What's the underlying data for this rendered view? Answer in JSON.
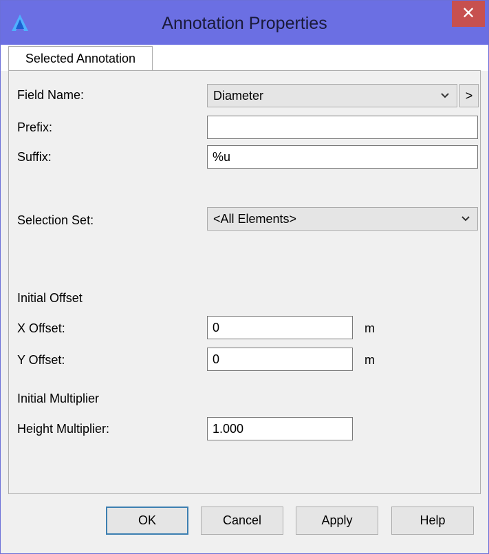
{
  "window": {
    "title": "Annotation Properties",
    "close_glyph": "✕",
    "app_icon": "app-logo-icon",
    "titlebar_color": "#6b6fe3",
    "close_color": "#c7504f"
  },
  "tabs": [
    {
      "label": "Selected Annotation",
      "active": true
    }
  ],
  "form": {
    "field_name": {
      "label": "Field Name:",
      "value": "Diameter",
      "more_button": ">"
    },
    "prefix": {
      "label": "Prefix:",
      "value": ""
    },
    "suffix": {
      "label": "Suffix:",
      "value": "%u"
    },
    "selection_set": {
      "label": "Selection Set:",
      "value": "<All Elements>"
    },
    "initial_offset": {
      "heading": "Initial Offset",
      "x": {
        "label": "X Offset:",
        "value": "0",
        "unit": "m"
      },
      "y": {
        "label": "Y Offset:",
        "value": "0",
        "unit": "m"
      }
    },
    "initial_multiplier": {
      "heading": "Initial Multiplier",
      "height": {
        "label": "Height Multiplier:",
        "value": "1.000"
      }
    }
  },
  "buttons": {
    "ok": "OK",
    "cancel": "Cancel",
    "apply": "Apply",
    "help": "Help"
  }
}
